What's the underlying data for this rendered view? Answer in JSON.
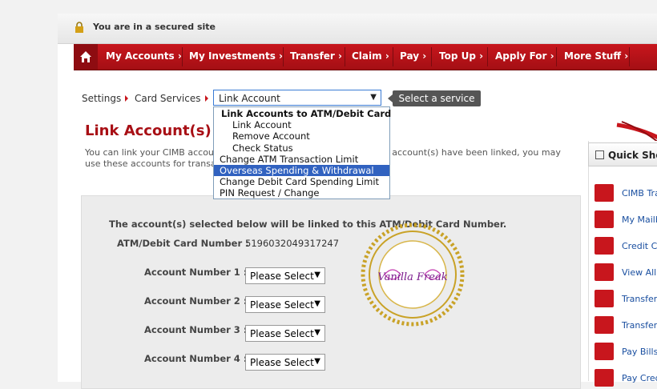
{
  "secure_bar": {
    "text": "You are in a secured site"
  },
  "nav": {
    "items": [
      "My Accounts",
      "My Investments",
      "Transfer",
      "Claim",
      "Pay",
      "Top Up",
      "Apply For",
      "More Stuff"
    ]
  },
  "breadcrumb": {
    "items": [
      "Settings",
      "Card Services"
    ],
    "select_value": "Link Account",
    "tooltip": "Select a service"
  },
  "dropdown": {
    "options": [
      "Link Accounts to ATM/Debit Card",
      "Link Account",
      "Remove Account",
      "Check Status",
      "Change ATM Transaction Limit",
      "Overseas Spending & Withdrawal",
      "Change Debit Card Spending Limit",
      "PIN Request / Change"
    ],
    "selected": "Overseas Spending & Withdrawal"
  },
  "page": {
    "title": "Link Account(s)",
    "desc_a": "You can link your CIMB accou",
    "desc_b": "e account(s) have been linked, you may",
    "desc_c": "use these accounts for transa"
  },
  "form": {
    "heading": "The account(s) selected below will be linked to this ATM/Debit Card Number.",
    "card_label": "ATM/Debit Card Number :",
    "card_value": "5196032049317247",
    "accounts": [
      {
        "label": "Account Number 1 :",
        "value": "Please Select"
      },
      {
        "label": "Account Number 2 :",
        "value": "Please Select"
      },
      {
        "label": "Account Number 3 :",
        "value": "Please Select"
      },
      {
        "label": "Account Number 4 :",
        "value": "Please Select"
      }
    ]
  },
  "stamp": {
    "text": "Vanilla Freak",
    "url": "http://alfarhansaid.blogspot.my",
    "copyright": "Copyright Reserved"
  },
  "quick_shortcuts": {
    "title": "Quick Sho",
    "items": [
      "CIMB Tra",
      "My Mailb",
      "Credit Ca",
      "View All",
      "Transfer",
      "Transfer",
      "Pay Bills",
      "Pay Cred"
    ]
  },
  "colors": {
    "brand": "#c8161d",
    "link": "#1a4fa0",
    "selected": "#3162c0"
  }
}
